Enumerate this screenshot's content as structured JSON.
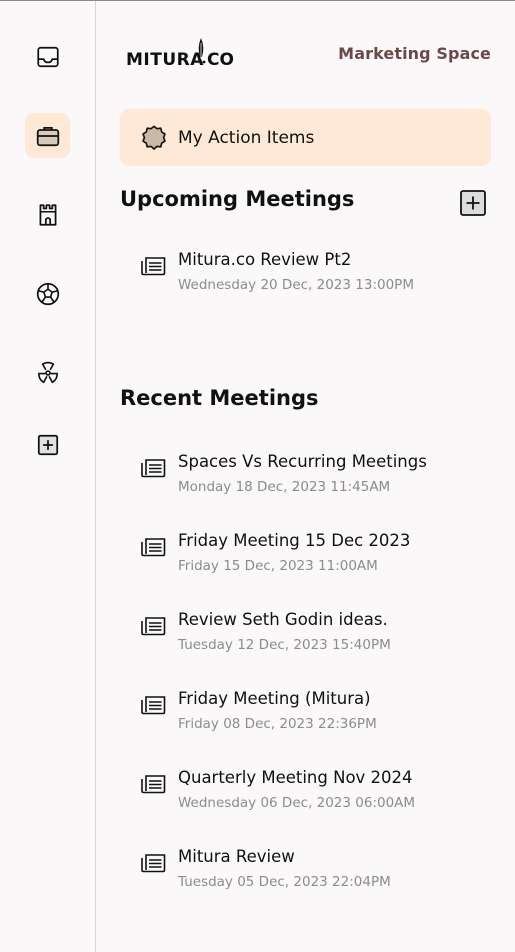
{
  "sidebar": {
    "items": [
      {
        "icon": "inbox-icon"
      },
      {
        "icon": "briefcase-icon",
        "active": true
      },
      {
        "icon": "castle-icon"
      },
      {
        "icon": "soccer-ball-icon"
      },
      {
        "icon": "radiation-icon"
      },
      {
        "icon": "plus-square-icon"
      }
    ]
  },
  "header": {
    "logo_text": "MITURA.CO",
    "space_name": "Marketing Space"
  },
  "action_items": {
    "label": "My Action Items"
  },
  "upcoming": {
    "title": "Upcoming Meetings",
    "meetings": [
      {
        "title": "Mitura.co Review Pt2",
        "date": "Wednesday 20 Dec, 2023 13:00PM"
      }
    ]
  },
  "recent": {
    "title": "Recent Meetings",
    "meetings": [
      {
        "title": "Spaces Vs Recurring Meetings",
        "date": "Monday 18 Dec, 2023 11:45AM"
      },
      {
        "title": "Friday Meeting 15 Dec 2023",
        "date": "Friday 15 Dec, 2023 11:00AM"
      },
      {
        "title": "Review Seth Godin ideas.",
        "date": "Tuesday 12 Dec, 2023 15:40PM"
      },
      {
        "title": "Friday Meeting (Mitura)",
        "date": "Friday 08 Dec, 2023 22:36PM"
      },
      {
        "title": "Quarterly Meeting Nov 2024",
        "date": "Wednesday 06 Dec, 2023 06:00AM"
      },
      {
        "title": "Mitura Review",
        "date": "Tuesday 05 Dec, 2023 22:04PM"
      }
    ]
  },
  "colors": {
    "accent_bg": "#fde9d5",
    "space_name": "#6b4949",
    "date_text": "#8c8c8c",
    "page_bg": "#faf8f8"
  }
}
